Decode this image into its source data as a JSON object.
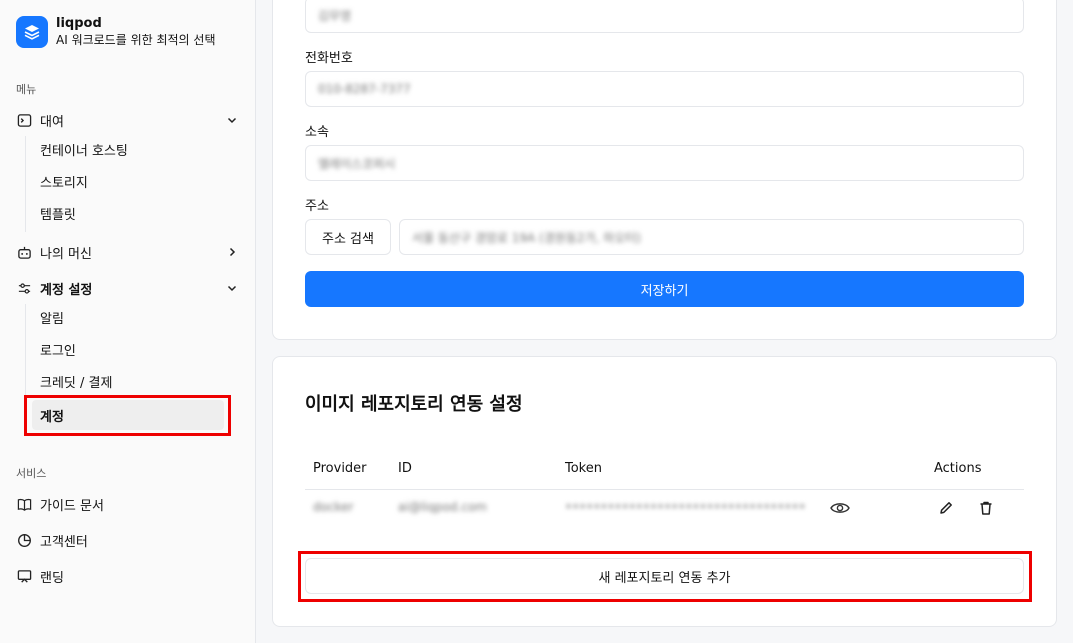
{
  "app": {
    "name": "liqpod",
    "tagline": "AI 워크로드를 위한 최적의 선택"
  },
  "sidebar": {
    "menu_label": "메뉴",
    "rent": {
      "label": "대여",
      "items": [
        "컨테이너 호스팅",
        "스토리지",
        "템플릿"
      ]
    },
    "my_machine": {
      "label": "나의 머신"
    },
    "account_settings": {
      "label": "계정 설정",
      "items": [
        "알림",
        "로그인",
        "크레딧 / 결제",
        "계정"
      ]
    },
    "services_label": "서비스",
    "services": [
      "가이드 문서",
      "고객센터",
      "랜딩"
    ]
  },
  "profile_form": {
    "name_value": "김무영",
    "phone_label": "전화번호",
    "phone_value": "010-8287-7377",
    "org_label": "소속",
    "org_value": "엘레이스코퍼시",
    "address_label": "주소",
    "address_search_button": "주소 검색",
    "address_value": "서울 동산구 경암로 19A (경원동2가, 하오터)",
    "save_button": "저장하기"
  },
  "registry": {
    "title": "이미지 레포지토리 연동 설정",
    "columns": {
      "provider": "Provider",
      "id": "ID",
      "token": "Token",
      "actions": "Actions"
    },
    "rows": [
      {
        "provider": "docker",
        "id": "ai@liqpod.com",
        "token": "••••••••••••••••••••••••••••••••••"
      }
    ],
    "add_button": "새 레포지토리 연동 추가"
  }
}
